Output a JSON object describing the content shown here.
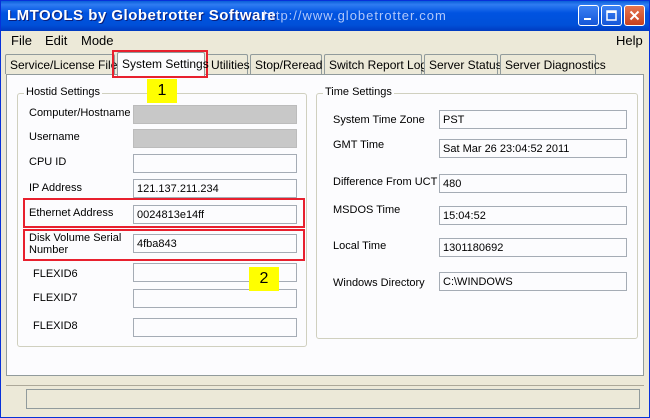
{
  "window": {
    "title": "LMTOOLS by Globetrotter Software",
    "title_url": "http://www.globetrotter.com"
  },
  "menu": {
    "file": "File",
    "edit": "Edit",
    "mode": "Mode",
    "help": "Help"
  },
  "tabs": [
    {
      "label": "Service/License File"
    },
    {
      "label": "System Settings"
    },
    {
      "label": "Utilities"
    },
    {
      "label": "Stop/Reread"
    },
    {
      "label": "Switch Report Log"
    },
    {
      "label": "Server Status"
    },
    {
      "label": "Server Diagnostics"
    }
  ],
  "hostid": {
    "title": "Hostid Settings",
    "computer_label": "Computer/Hostname",
    "computer_value": "",
    "username_label": "Username",
    "username_value": "",
    "cpu_label": "CPU ID",
    "cpu_value": "",
    "ip_label": "IP Address",
    "ip_value": "121.137.211.234",
    "ethernet_label": "Ethernet Address",
    "ethernet_value": "0024813e14ff",
    "disk_label": "Disk Volume Serial Number",
    "disk_value": "4fba843",
    "flexid6_label": "FLEXID6",
    "flexid6_value": "",
    "flexid7_label": "FLEXID7",
    "flexid7_value": "",
    "flexid8_label": "FLEXID8",
    "flexid8_value": ""
  },
  "time": {
    "title": "Time Settings",
    "tz_label": "System Time Zone",
    "tz_value": "PST",
    "gmt_label": "GMT Time",
    "gmt_value": "Sat Mar 26 23:04:52 2011",
    "diff_label": "Difference From UCT",
    "diff_value": "480",
    "msdos_label": "MSDOS Time",
    "msdos_value": "15:04:52",
    "local_label": "Local Time",
    "local_value": "1301180692",
    "windir_label": "Windows Directory",
    "windir_value": "C:\\WINDOWS"
  },
  "annotations": {
    "badge1": "1",
    "badge2": "2",
    "highlight_color": "#e8202e",
    "badge_color": "#ffff00"
  },
  "colors": {
    "titlebar": "#0053e1",
    "window_bg": "#ece9d8",
    "panel_bg": "#fcfcfe"
  }
}
